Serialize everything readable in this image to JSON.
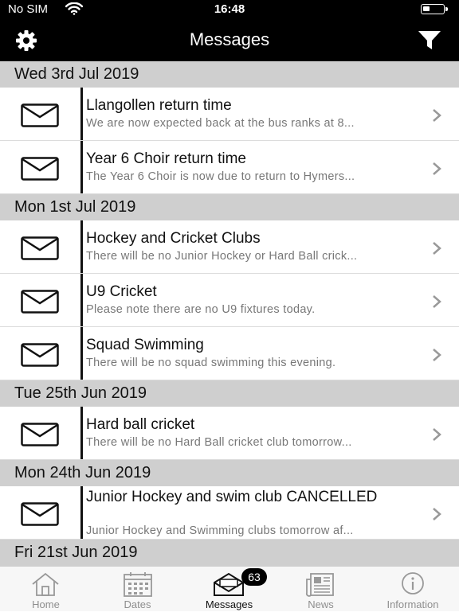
{
  "status_bar": {
    "carrier": "No SIM",
    "time": "16:48"
  },
  "nav": {
    "title": "Messages"
  },
  "sections": [
    {
      "date": "Wed 3rd Jul 2019",
      "messages": [
        {
          "title": "Llangollen return time",
          "preview": "We are now expected back at the bus ranks at 8..."
        },
        {
          "title": "Year 6 Choir return time",
          "preview": "The Year 6 Choir is now due to return to Hymers..."
        }
      ]
    },
    {
      "date": "Mon 1st Jul 2019",
      "messages": [
        {
          "title": "Hockey and Cricket Clubs",
          "preview": "There will be no Junior Hockey or Hard Ball crick..."
        },
        {
          "title": "U9 Cricket",
          "preview": "Please note there are no U9 fixtures today."
        },
        {
          "title": "Squad Swimming",
          "preview": "There will be no squad swimming this evening."
        }
      ]
    },
    {
      "date": "Tue 25th Jun 2019",
      "messages": [
        {
          "title": "Hard ball cricket",
          "preview": "There will be no Hard Ball cricket club tomorrow..."
        }
      ]
    },
    {
      "date": "Mon 24th Jun 2019",
      "messages": [
        {
          "title": "Junior Hockey and swim club CANCELLED",
          "preview": "Junior Hockey and Swimming clubs tomorrow af..."
        }
      ]
    },
    {
      "date": "Fri 21st Jun 2019",
      "messages": []
    }
  ],
  "tabs": [
    {
      "label": "Home",
      "icon": "home-icon"
    },
    {
      "label": "Dates",
      "icon": "calendar-icon"
    },
    {
      "label": "Messages",
      "icon": "envelope-icon",
      "badge": "63"
    },
    {
      "label": "News",
      "icon": "newspaper-icon"
    },
    {
      "label": "Information",
      "icon": "info-icon"
    }
  ],
  "colors": {
    "bar_background": "#000000",
    "section_header": "#cfcfcf",
    "preview_text": "#777777",
    "inactive_tab": "#8e8e8e"
  }
}
